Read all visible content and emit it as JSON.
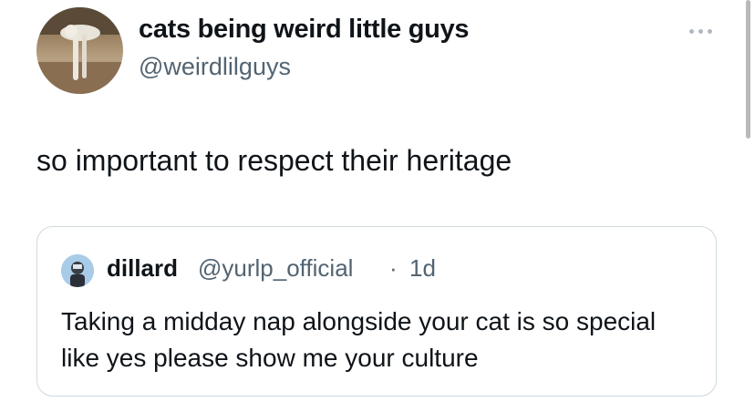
{
  "author": {
    "display_name": "cats being weird little guys",
    "handle": "@weirdlilguys",
    "avatar_icon": "cat-photo-avatar"
  },
  "tweet": {
    "text": "so important to respect their heritage"
  },
  "more_icon": "ellipsis-icon",
  "quote": {
    "display_name": "dillard",
    "handle": "@yurlp_official",
    "separator": "·",
    "time": "1d",
    "text": "Taking a midday nap alongside your cat is so special like yes please show me your culture",
    "avatar_icon": "user-avatar"
  },
  "colors": {
    "text_primary": "#0f1419",
    "text_secondary": "#536471",
    "card_border": "#cfd9de"
  }
}
